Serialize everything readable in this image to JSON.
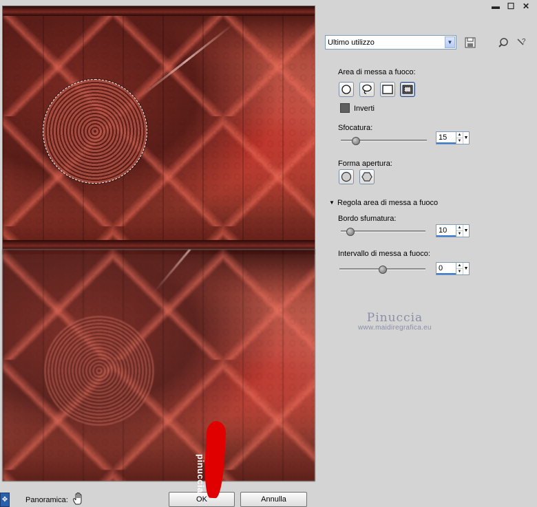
{
  "window": {
    "minimize_glyph": "▬",
    "maximize_glyph": "☐",
    "close_glyph": "✕"
  },
  "preset": {
    "value": "Ultimo utilizzo"
  },
  "focus_area": {
    "label": "Area di messa a fuoco:",
    "invert_label": "Inverti",
    "invert_checked": true
  },
  "blur": {
    "label": "Sfocatura:",
    "value": "15",
    "slider_fraction": 0.15
  },
  "aperture": {
    "label": "Forma apertura:"
  },
  "adjust": {
    "section_label": "Regola area di messa a fuoco",
    "feather_label": "Bordo sfumatura:",
    "feather_value": "10",
    "feather_fraction": 0.1,
    "range_label": "Intervallo di messa a fuoco:",
    "range_value": "0",
    "range_fraction": 0.5
  },
  "watermark": {
    "name": "Pinuccia",
    "url": "www.maidiregrafica.eu"
  },
  "footer": {
    "pan_label": "Panoramica:",
    "ok_label": "OK",
    "cancel_label": "Annulla"
  },
  "stamp": {
    "text": "pinuccia",
    "color": "#e00000"
  },
  "colors": {
    "panel_bg": "#d4d4d4",
    "spin_underline": "#3a7bd5"
  }
}
